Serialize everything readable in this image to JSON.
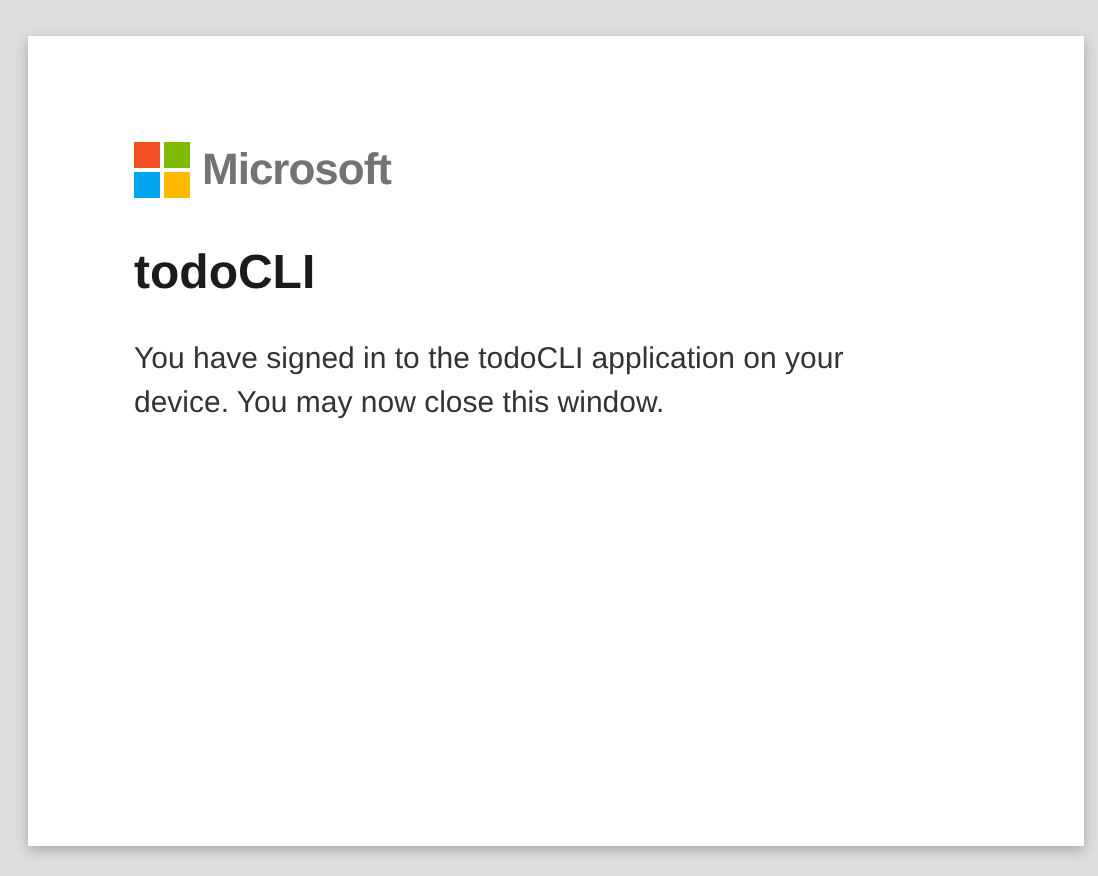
{
  "brand": {
    "name": "Microsoft"
  },
  "title": "todoCLI",
  "message": "You have signed in to the todoCLI application on your device. You may now close this window."
}
